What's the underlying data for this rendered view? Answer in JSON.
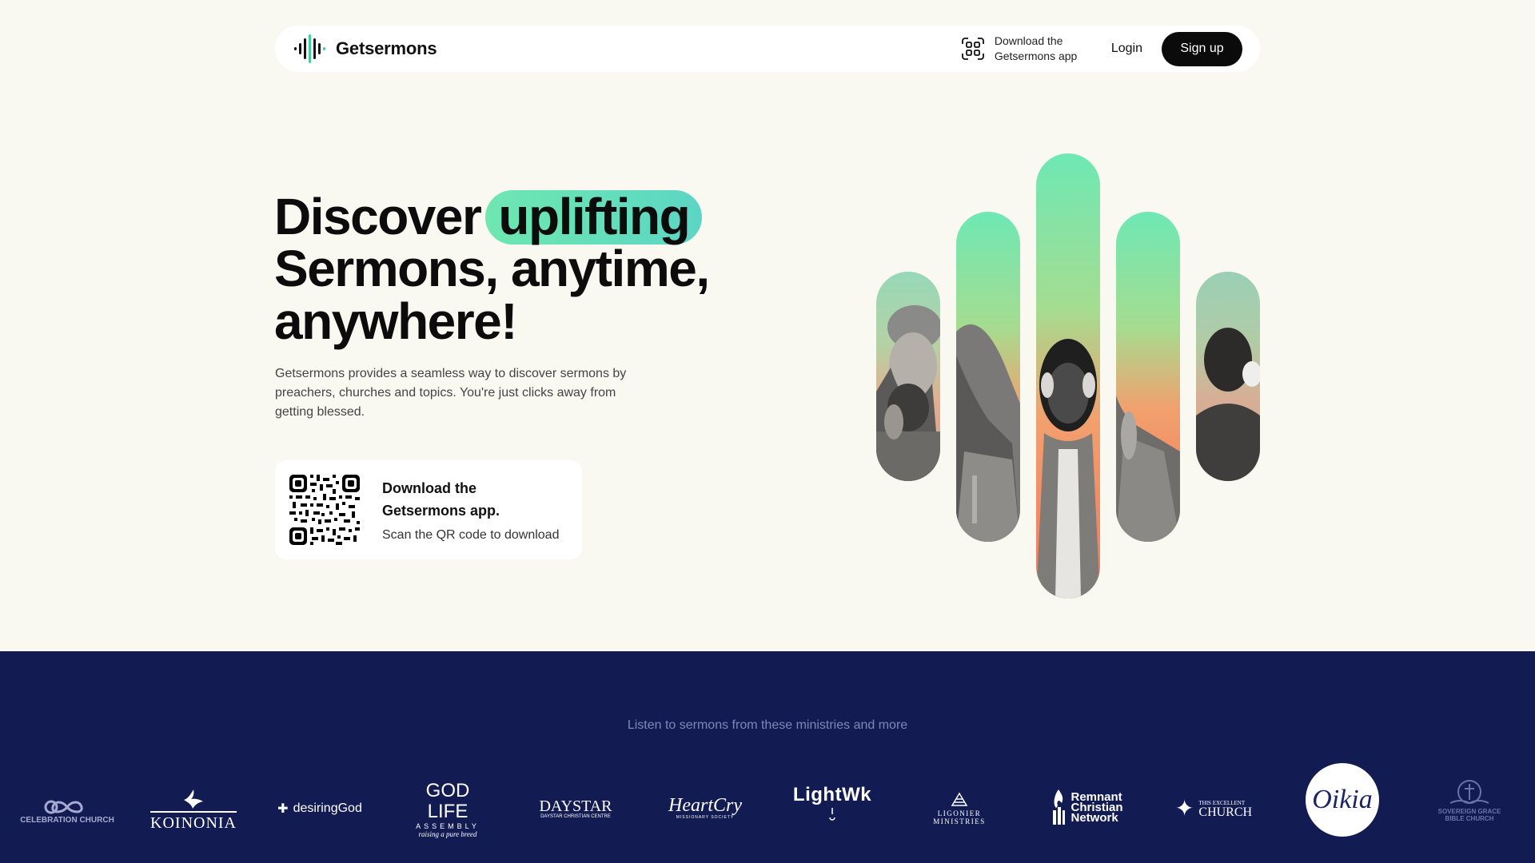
{
  "brand": {
    "name": "Getsermons"
  },
  "nav": {
    "app_link_line1": "Download the",
    "app_link_line2": "Getsermons app",
    "login": "Login",
    "signup": "Sign up"
  },
  "hero": {
    "title_word1": "Discover",
    "title_highlight": "uplifting",
    "title_line2": "Sermons, anytime,",
    "title_line3": "anywhere!",
    "description": "Getsermons provides a seamless way to discover sermons by preachers, churches and topics. You're just clicks away from getting blessed."
  },
  "qr_card": {
    "title": "Download the Getsermons app.",
    "subtitle": "Scan the QR code to download"
  },
  "ministries": {
    "caption": "Listen to sermons from these ministries and more",
    "logos": [
      {
        "text": "CELEBRATION CHURCH",
        "icon": "infinity-icon"
      },
      {
        "text": "KOINONIA",
        "icon": "dove-icon"
      },
      {
        "text": "desiringGod",
        "icon": "cross-mark-icon"
      },
      {
        "text": "GOD LIFE",
        "sub": "ASSEMBLY",
        "tag": "raising a pure breed"
      },
      {
        "text": "DAYSTAR",
        "sub": "DAYSTAR CHRISTIAN CENTRE"
      },
      {
        "text": "HeartCry",
        "sub": "MISSIONARY SOCIETY"
      },
      {
        "text": "LightWk"
      },
      {
        "text": "LIGONIER MINISTRIES",
        "icon": "ligonier-icon"
      },
      {
        "text": "Remnant",
        "sub": "Christian",
        "tag": "Network"
      },
      {
        "text": "CHURCH",
        "sub": "THIS EXCELLENT"
      },
      {
        "text": "Oikia"
      },
      {
        "text": "SOVEREIGN GRACE",
        "sub": "BIBLE CHURCH"
      }
    ]
  },
  "colors": {
    "background": "#f9f8f1",
    "highlight": "#6ee7b0",
    "band": "#131c52",
    "button": "#0b0b0b"
  }
}
